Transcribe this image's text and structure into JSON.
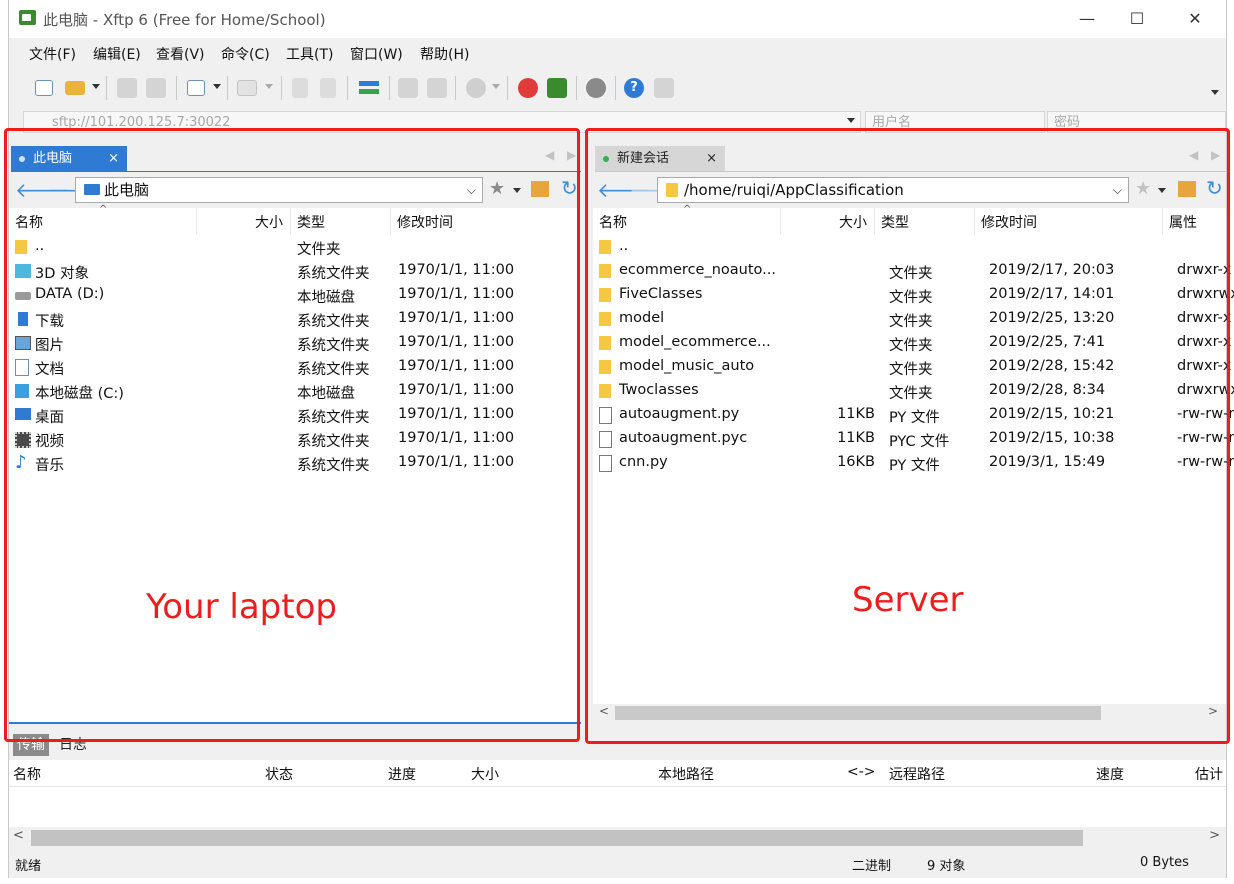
{
  "window": {
    "title": "此电脑 - Xftp 6 (Free for Home/School)",
    "min_glyph": "—",
    "max_glyph": "☐",
    "close_glyph": "✕"
  },
  "menu": [
    "文件(F)",
    "编辑(E)",
    "查看(V)",
    "命令(C)",
    "工具(T)",
    "窗口(W)",
    "帮助(H)"
  ],
  "address": {
    "host_value": "sftp://101.200.125.7:30022",
    "user_placeholder": "用户名",
    "pass_placeholder": "密码"
  },
  "local": {
    "tab_label": "此电脑",
    "tab_close": "×",
    "path": "此电脑",
    "columns": [
      "名称",
      "大小",
      "类型",
      "修改时间"
    ],
    "rows": [
      {
        "name": "..",
        "size": "",
        "type": "文件夹",
        "modified": "",
        "icon": "folder-icon"
      },
      {
        "name": "3D 对象",
        "size": "",
        "type": "系统文件夹",
        "modified": "1970/1/1, 11:00",
        "icon": "3d-objects-icon"
      },
      {
        "name": "DATA (D:)",
        "size": "",
        "type": "本地磁盘",
        "modified": "1970/1/1, 11:00",
        "icon": "drive-icon"
      },
      {
        "name": "下载",
        "size": "",
        "type": "系统文件夹",
        "modified": "1970/1/1, 11:00",
        "icon": "download-icon"
      },
      {
        "name": "图片",
        "size": "",
        "type": "系统文件夹",
        "modified": "1970/1/1, 11:00",
        "icon": "pictures-icon"
      },
      {
        "name": "文档",
        "size": "",
        "type": "系统文件夹",
        "modified": "1970/1/1, 11:00",
        "icon": "documents-icon"
      },
      {
        "name": "本地磁盘 (C:)",
        "size": "",
        "type": "本地磁盘",
        "modified": "1970/1/1, 11:00",
        "icon": "windows-drive-icon"
      },
      {
        "name": "桌面",
        "size": "",
        "type": "系统文件夹",
        "modified": "1970/1/1, 11:00",
        "icon": "desktop-icon"
      },
      {
        "name": "视频",
        "size": "",
        "type": "系统文件夹",
        "modified": "1970/1/1, 11:00",
        "icon": "videos-icon"
      },
      {
        "name": "音乐",
        "size": "",
        "type": "系统文件夹",
        "modified": "1970/1/1, 11:00",
        "icon": "music-icon"
      }
    ]
  },
  "remote": {
    "tab_label": "新建会话",
    "tab_close": "×",
    "path": "/home/ruiqi/AppClassification",
    "columns": [
      "名称",
      "大小",
      "类型",
      "修改时间",
      "属性"
    ],
    "rows": [
      {
        "name": "..",
        "size": "",
        "type": "",
        "modified": "",
        "attr": "",
        "icon": "folder-icon"
      },
      {
        "name": "ecommerce_noauto...",
        "size": "",
        "type": "文件夹",
        "modified": "2019/2/17, 20:03",
        "attr": "drwxr-x",
        "icon": "folder-icon"
      },
      {
        "name": "FiveClasses",
        "size": "",
        "type": "文件夹",
        "modified": "2019/2/17, 14:01",
        "attr": "drwxrwx",
        "icon": "folder-icon"
      },
      {
        "name": "model",
        "size": "",
        "type": "文件夹",
        "modified": "2019/2/25, 13:20",
        "attr": "drwxr-x",
        "icon": "folder-icon"
      },
      {
        "name": "model_ecommerce...",
        "size": "",
        "type": "文件夹",
        "modified": "2019/2/25, 7:41",
        "attr": "drwxr-x",
        "icon": "folder-icon"
      },
      {
        "name": "model_music_auto",
        "size": "",
        "type": "文件夹",
        "modified": "2019/2/28, 15:42",
        "attr": "drwxr-x",
        "icon": "folder-icon"
      },
      {
        "name": "Twoclasses",
        "size": "",
        "type": "文件夹",
        "modified": "2019/2/28, 8:34",
        "attr": "drwxrwx",
        "icon": "folder-icon"
      },
      {
        "name": "autoaugment.py",
        "size": "11KB",
        "type": "PY 文件",
        "modified": "2019/2/15, 10:21",
        "attr": "-rw-rw-r",
        "icon": "file-icon"
      },
      {
        "name": "autoaugment.pyc",
        "size": "11KB",
        "type": "PYC 文件",
        "modified": "2019/2/15, 10:38",
        "attr": "-rw-rw-r",
        "icon": "file-icon"
      },
      {
        "name": "cnn.py",
        "size": "16KB",
        "type": "PY 文件",
        "modified": "2019/3/1, 15:49",
        "attr": "-rw-rw-r",
        "icon": "file-icon"
      }
    ]
  },
  "transfer": {
    "tabs": [
      "传输",
      "日志"
    ],
    "columns": [
      "名称",
      "状态",
      "进度",
      "大小",
      "本地路径",
      "<->",
      "远程路径",
      "速度",
      "估计"
    ]
  },
  "status": {
    "left": "就绪",
    "mode": "二进制",
    "count": "9 对象",
    "bytes": "0 Bytes"
  },
  "annotations": {
    "local_label": "Your laptop",
    "remote_label": "Server",
    "color": "#ee1c1c"
  }
}
